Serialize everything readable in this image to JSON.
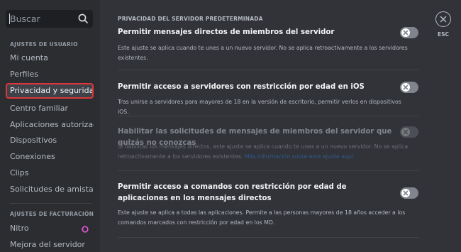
{
  "search": {
    "placeholder": "Buscar"
  },
  "sidebar": {
    "user_settings_header": "Ajustes de usuario",
    "user_items": [
      "Mi cuenta",
      "Perfiles",
      "Privacidad y seguridad",
      "Centro familiar",
      "Aplicaciones autorizad...",
      "Dispositivos",
      "Conexiones",
      "Clips",
      "Solicitudes de amistad"
    ],
    "billing_header": "Ajustes de facturación",
    "billing_items": [
      "Nitro",
      "Mejora del servidor"
    ]
  },
  "main": {
    "header": "Privacidad del servidor predeterminada",
    "settings": [
      {
        "title": "Permitir mensajes directos de miembros del servidor",
        "desc": "Este ajuste se aplica cuando te unes a un nuevo servidor. No se aplica retroactivamente a los servidores existentes.",
        "enabled": false
      },
      {
        "title": "Permitir acceso a servidores con restricción por edad en iOS",
        "desc": "Tras unirse a servidores para mayores de 18 en la versión de escritorio, permitir verlos en dispositivos iOS.",
        "enabled": false
      },
      {
        "title": "Habilitar las solicitudes de mensajes de miembros del servidor que quizás no conozcas",
        "desc": "Si habilitas los mensajes directos, este ajuste se aplica cuando te unes a un nuevo servidor. No se aplica retroactivamente a los servidores existentes.",
        "link": "Más información sobre este ajuste aquí.",
        "enabled": false,
        "disabled": true
      },
      {
        "title": "Permitir acceso a comandos con restricción por edad de aplicaciones en los mensajes directos",
        "desc": "Este ajuste se aplica a todas las aplicaciones. Permite a las personas mayores de 18 años acceder a los comandos marcados con restricción por edad en los MD.",
        "enabled": false
      }
    ]
  },
  "close": {
    "label": "ESC"
  },
  "colors": {
    "selected_outline": "#da373c",
    "nitro_accent": "#e158d7",
    "link": "#2e5a8c"
  }
}
